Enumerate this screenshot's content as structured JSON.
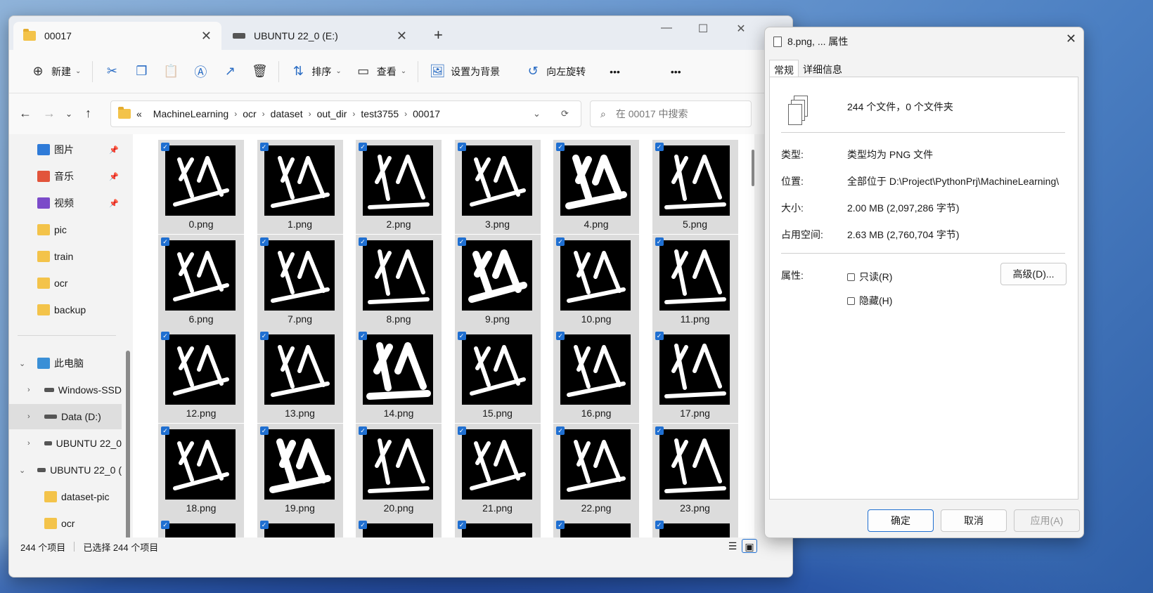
{
  "colors": {
    "accent": "#1f6fd1",
    "folder": "#f3c34a",
    "selected_bg": "#dcdcdc"
  },
  "explorer": {
    "tabs": [
      {
        "label": "00017",
        "icon": "folder-icon"
      },
      {
        "label": "UBUNTU 22_0 (E:)",
        "icon": "drive-icon"
      }
    ],
    "toolbar": {
      "new_label": "新建",
      "sort_label": "排序",
      "view_label": "查看",
      "set_bg_label": "设置为背景",
      "rotate_left_label": "向左旋转",
      "more_label": "•••"
    },
    "address": {
      "overflow": "«",
      "crumbs": [
        "MachineLearning",
        "ocr",
        "dataset",
        "out_dir",
        "test3755",
        "00017"
      ]
    },
    "search_placeholder": "在 00017 中搜索",
    "sidebar": [
      {
        "label": "图片",
        "icon": "pictures-icon",
        "pinned": true
      },
      {
        "label": "音乐",
        "icon": "music-icon",
        "pinned": true
      },
      {
        "label": "视频",
        "icon": "videos-icon",
        "pinned": true
      },
      {
        "label": "pic",
        "icon": "folder-icon"
      },
      {
        "label": "train",
        "icon": "folder-icon"
      },
      {
        "label": "ocr",
        "icon": "folder-icon"
      },
      {
        "label": "backup",
        "icon": "folder-icon"
      },
      {
        "label": "此电脑",
        "icon": "this-pc-icon"
      },
      {
        "label": "Windows-SSD",
        "icon": "drive-icon"
      },
      {
        "label": "Data (D:)",
        "icon": "drive-icon"
      },
      {
        "label": "UBUNTU 22_0",
        "icon": "drive-icon"
      },
      {
        "label": "UBUNTU 22_0 (",
        "icon": "drive-icon"
      },
      {
        "label": "dataset-pic",
        "icon": "folder-icon"
      },
      {
        "label": "ocr",
        "icon": "folder-icon"
      }
    ],
    "files": [
      "0.png",
      "1.png",
      "2.png",
      "3.png",
      "4.png",
      "5.png",
      "6.png",
      "7.png",
      "8.png",
      "9.png",
      "10.png",
      "11.png",
      "12.png",
      "13.png",
      "14.png",
      "15.png",
      "16.png",
      "17.png",
      "18.png",
      "19.png",
      "20.png",
      "21.png",
      "22.png",
      "23.png"
    ],
    "status": {
      "count": "244 个项目",
      "selected": "已选择 244 个项目"
    }
  },
  "properties": {
    "title": "8.png, ... 属性",
    "tabs": [
      "常规",
      "详细信息"
    ],
    "summary": "244 个文件，0 个文件夹",
    "rows": [
      {
        "label": "类型:",
        "value": "类型均为 PNG 文件"
      },
      {
        "label": "位置:",
        "value": "全部位于 D:\\Project\\PythonPrj\\MachineLearning\\"
      },
      {
        "label": "大小:",
        "value": "2.00 MB (2,097,286 字节)"
      },
      {
        "label": "占用空间:",
        "value": "2.63 MB (2,760,704 字节)"
      }
    ],
    "attributes_label": "属性:",
    "readonly_label": "只读(R)",
    "hidden_label": "隐藏(H)",
    "advanced_label": "高级(D)...",
    "ok_label": "确定",
    "cancel_label": "取消",
    "apply_label": "应用(A)"
  }
}
